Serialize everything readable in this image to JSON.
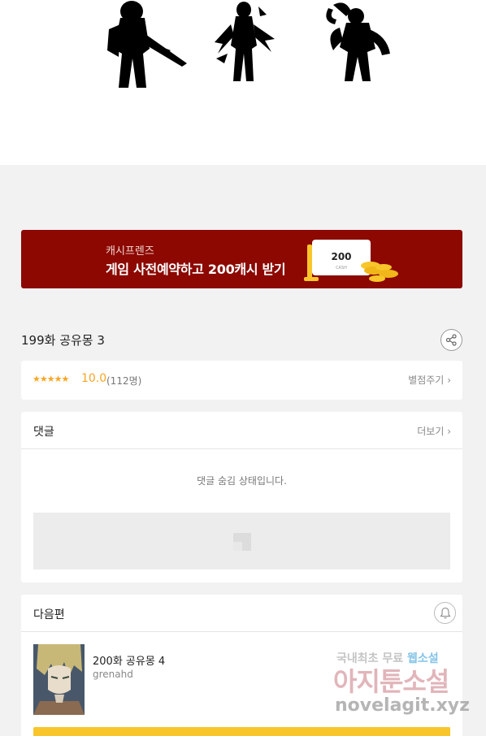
{
  "banner": {
    "brand": "캐시프렌즈",
    "headline": "게임 사전예약하고 200캐시 받기",
    "coin_amount": "200",
    "coin_caption": "CASH"
  },
  "episode": {
    "title": "199화 공유몽 3"
  },
  "rating": {
    "stars": "★★★★★",
    "score": "10.0",
    "count": "(112명)",
    "rate_link": "별점주기"
  },
  "comments": {
    "label": "댓글",
    "more": "더보기",
    "hidden_message": "댓글 숨김 상태입니다."
  },
  "next": {
    "label": "다음편",
    "title": "200화 공유몽 4",
    "author": "grenahd"
  },
  "watermark": {
    "line1_a": "국내최초 무료 ",
    "line1_b": "웹소설",
    "line2": "아지툰소설",
    "line3": "novelagit.xyz"
  },
  "icons": {
    "share": "share-icon",
    "bell": "bell-icon",
    "chevron": "chevron-right-icon"
  }
}
